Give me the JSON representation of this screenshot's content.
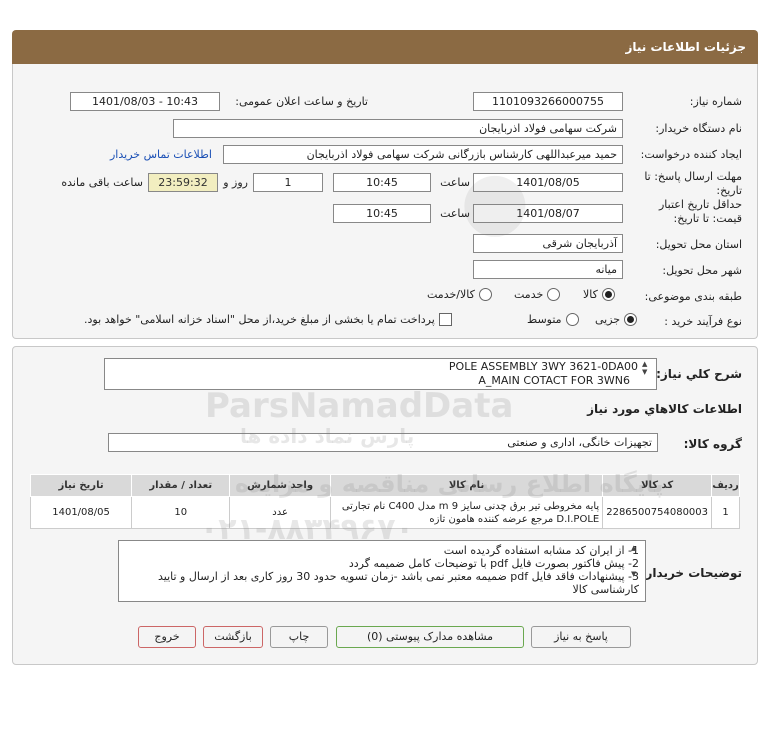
{
  "header": {
    "title": "جزئیات اطلاعات نیاز"
  },
  "form": {
    "need_number_label": "شماره نیاز:",
    "need_number": "1101093266000755",
    "announce_label": "تاریخ و ساعت اعلان عمومی:",
    "announce_value": "1401/08/03 - 10:43",
    "buyer_org_label": "نام دستگاه خریدار:",
    "buyer_org": "شرکت سهامی فولاد اذربایجان",
    "requester_label": "ایجاد کننده درخواست:",
    "requester": "حمید میرعبداللهی کارشناس بازرگانی شرکت سهامی فولاد اذربایجان",
    "contact_link": "اطلاعات تماس خریدار",
    "deadline_label": "مهلت ارسال پاسخ: تا تاریخ:",
    "deadline_date": "1401/08/05",
    "time_label": "ساعت",
    "deadline_time": "10:45",
    "days_value": "1",
    "days_label": "روز و",
    "remaining_time": "23:59:32",
    "remaining_label": "ساعت باقی مانده",
    "validity_label": "حداقل تاریخ اعتبار قیمت: تا تاریخ:",
    "validity_date": "1401/08/07",
    "validity_time": "10:45",
    "province_label": "استان محل تحویل:",
    "province": "آذربایجان شرقی",
    "city_label": "شهر محل تحویل:",
    "city": "میانه",
    "category_label": "طبقه بندی موضوعی:",
    "category_options": [
      "کالا",
      "خدمت",
      "کالا/خدمت"
    ],
    "process_label": "نوع فرآیند خرید :",
    "process_options": [
      "جزیی",
      "متوسط"
    ],
    "payment_note": "پرداخت تمام یا بخشی از مبلغ خرید،از محل \"اسناد خزانه اسلامی\" خواهد بود."
  },
  "details": {
    "summary_label": "شرح کلي نياز:",
    "summary_line1": "POLE ASSEMBLY 3WY 3621-0DA00",
    "summary_line2": "A_MAIN COTACT FOR 3WN6",
    "goods_info_title": "اطلاعات کالاهاي مورد نياز",
    "goods_group_label": "گروه کالا:",
    "goods_group": "تجهیزات خانگی، اداری و صنعتی",
    "table": {
      "headers": [
        "ردیف",
        "کد کالا",
        "نام کالا",
        "واحد شمارش",
        "تعداد / مقدار",
        "تاریخ نیاز"
      ],
      "rows": [
        [
          "1",
          "2286500754080003",
          "پایه مخروطی تیر برق چدنی سایز 9 m مدل C400 نام تجارتی D.I.POLE مرجع عرضه کننده هامون تازه",
          "عدد",
          "10",
          "1401/08/05"
        ]
      ]
    },
    "buyer_notes_label": "توضیحات خریدار:",
    "buyer_notes": [
      "1- از ایران کد مشابه استفاده گردیده است",
      "2- پیش فاکتور بصورت فایل pdf با توضیحات کامل ضمیمه گردد",
      "3- پیشنهادات فاقد فایل pdf  ضمیمه معتبر نمی باشد -زمان تسویه حدود 30 روز کاری بعد از ارسال و تایید کارشناسی کالا"
    ]
  },
  "buttons": {
    "reply": "پاسخ به نیاز",
    "attachments": "مشاهده مدارک پیوستی (0)",
    "print": "چاپ",
    "back": "بازگشت",
    "exit": "خروج"
  },
  "watermark": {
    "brand": "ParsNamadData",
    "line1": "پایگاه اطلاع رسانی مناقصه و مزایده",
    "line2": "پارس نماد داده ها",
    "phone": "۰۲۱-۸۸۳۴۹۶۷۰"
  }
}
